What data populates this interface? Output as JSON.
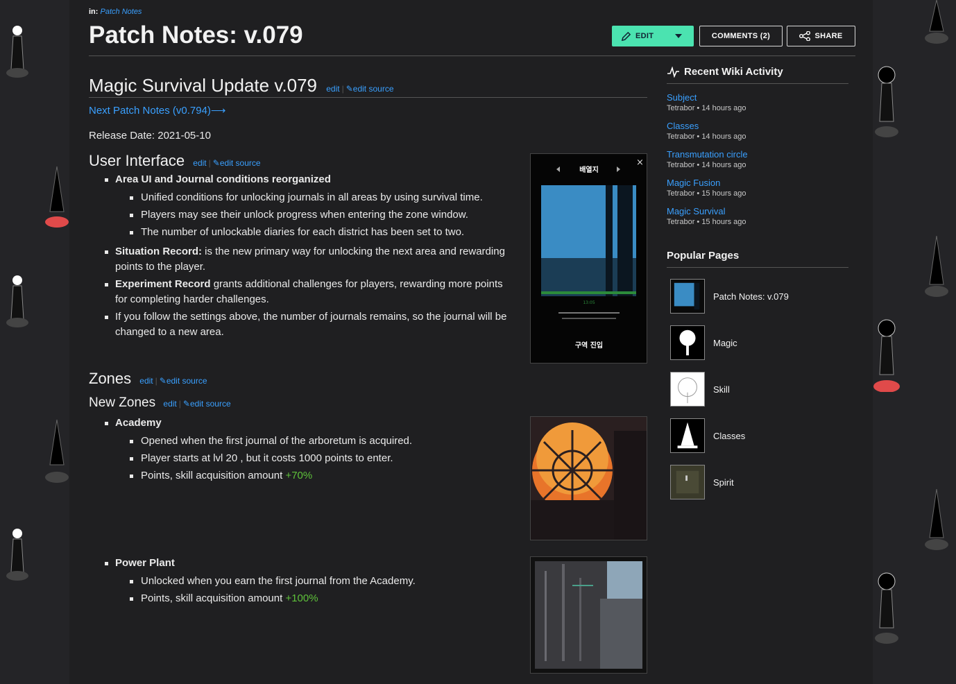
{
  "breadcrumb": {
    "prefix": "in:",
    "link": "Patch Notes"
  },
  "page_title": "Patch Notes: v.079",
  "actions": {
    "edit": "EDIT",
    "comments": "COMMENTS (2)",
    "share": "SHARE"
  },
  "edit_links": {
    "edit": "edit",
    "edit_source": "edit source"
  },
  "main": {
    "heading": "Magic Survival Update v.079",
    "next_link": "Next Patch Notes (v0.794)⟶",
    "release": "Release Date: 2021-05-10",
    "ui_section": {
      "heading": "User Interface",
      "item1_title": "Area UI and Journal conditions reorganized",
      "item1_sub": [
        "Unified conditions for unlocking journals in all areas by using survival time.",
        "Players may see their unlock progress when entering the zone window.",
        "The number of unlockable diaries for each district has been set to two."
      ],
      "item2_bold": "Situation Record:",
      "item2_rest": " is the new primary way for unlocking the next area and rewarding points to the player.",
      "item3_bold": "Experiment Record",
      "item3_rest": " grants additional challenges for players, rewarding more points for completing harder challenges.",
      "item4": "If you follow the settings above, the number of journals remains, so the journal will be changed to a new area."
    },
    "zones_heading": "Zones",
    "new_zones_heading": "New Zones",
    "academy": {
      "title": "Academy",
      "line1": "Opened when the first journal of the arboretum is acquired.",
      "line2": "Player starts at lvl 20 , but it costs 1000 points to enter.",
      "line3_text": "Points, skill acquisition amount ",
      "line3_value": "+70%"
    },
    "power_plant": {
      "title": "Power Plant",
      "line1": "Unlocked when you earn the first journal from the Academy.",
      "line2_text": "Points, skill acquisition amount ",
      "line2_value": "+100%"
    },
    "screenshot": {
      "header": "배열지",
      "footer": "구역 진입",
      "timer": "13:05"
    }
  },
  "sidebar": {
    "activity_heading": "Recent Wiki Activity",
    "activity": [
      {
        "title": "Subject",
        "meta": "Tetrabor • 14 hours ago"
      },
      {
        "title": "Classes",
        "meta": "Tetrabor • 14 hours ago"
      },
      {
        "title": "Transmutation circle",
        "meta": "Tetrabor • 14 hours ago"
      },
      {
        "title": "Magic Fusion",
        "meta": "Tetrabor • 15 hours ago"
      },
      {
        "title": "Magic Survival",
        "meta": "Tetrabor • 15 hours ago"
      }
    ],
    "popular_heading": "Popular Pages",
    "popular": [
      "Patch Notes: v.079",
      "Magic",
      "Skill",
      "Classes",
      "Spirit"
    ]
  },
  "colors": {
    "accent": "#4be3b0",
    "link": "#3aa0ff",
    "green": "#5ec13a",
    "background": "#242427"
  }
}
